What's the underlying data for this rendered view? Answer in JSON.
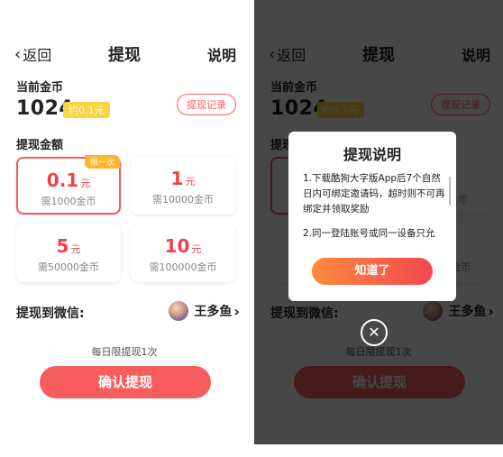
{
  "header": {
    "back_label": "返回",
    "title": "提现",
    "explain_label": "说明"
  },
  "balance": {
    "label": "当前金币",
    "coins": "1024",
    "approx": "约0.1元",
    "record_label": "提现记录"
  },
  "amount_label": "提现金额",
  "options": [
    {
      "value": "0.1",
      "unit": "元",
      "cost": "需1000金币",
      "tag": "限一次",
      "selected": true
    },
    {
      "value": "1",
      "unit": "元",
      "cost": "需10000金币"
    },
    {
      "value": "5",
      "unit": "元",
      "cost": "需50000金币"
    },
    {
      "value": "10",
      "unit": "元",
      "cost": "需100000金币"
    }
  ],
  "wechat": {
    "label": "提现到微信:",
    "user": "王多鱼"
  },
  "limit_text": "每日限提现1次",
  "confirm_label": "确认提现",
  "dialog": {
    "title": "提现说明",
    "rule1": "1.下载酷狗大字版App后7个自然日内可绑定邀请码，超时则不可再绑定并领取奖励",
    "rule2": "2.同一登陆账号或同一设备只允",
    "ok_label": "知道了"
  },
  "colors": {
    "accent": "#f85d5d",
    "badge": "#ffd23f",
    "tag": "#ffb42e"
  },
  "icons": {
    "back": "chevron-left-icon",
    "user_arrow": "chevron-right-icon",
    "close": "close-circle-icon"
  }
}
